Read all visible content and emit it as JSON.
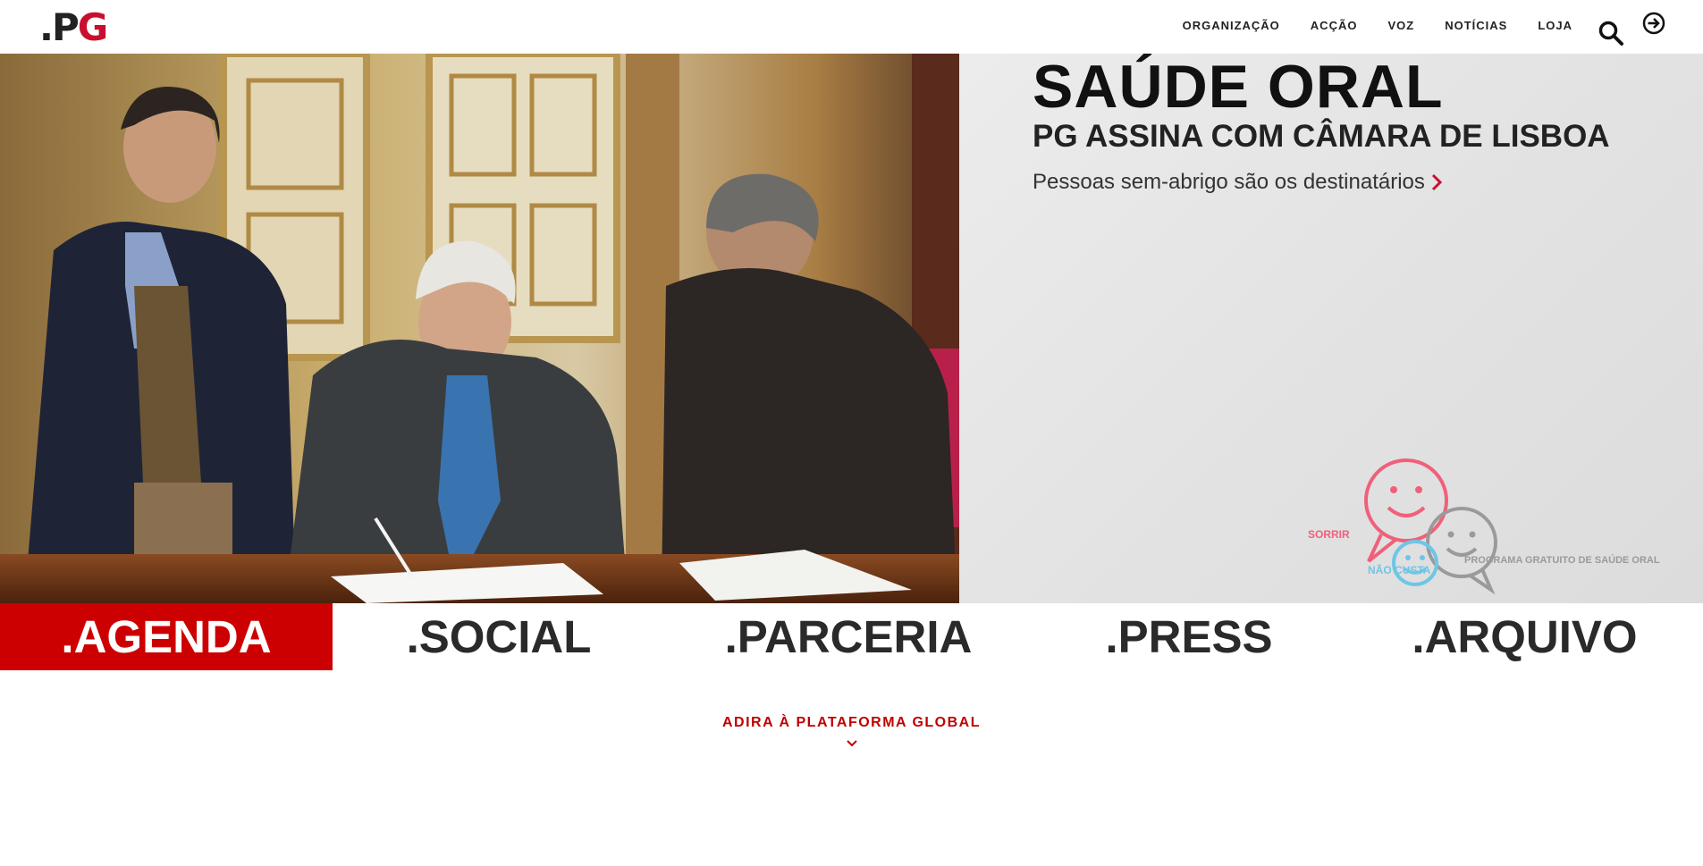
{
  "brand": {
    "logo_prefix": ".P",
    "logo_accent": "G",
    "accent_color": "#c8102e"
  },
  "nav": {
    "items": [
      {
        "label": "ORGANIZAÇÃO"
      },
      {
        "label": "ACÇÃO"
      },
      {
        "label": "VOZ"
      },
      {
        "label": "NOTÍCIAS"
      },
      {
        "label": "LOJA"
      }
    ],
    "search_icon": "search-icon",
    "login_icon": "login-arrow-icon"
  },
  "hero": {
    "title": "SAÚDE ORAL",
    "subtitle": "PG ASSINA COM CÂMARA DE LISBOA",
    "link_text": "Pessoas sem-abrigo são os destinatários",
    "promo": {
      "sorrir": "SORRIR",
      "nao_custa": "NÃO CUSTA",
      "programa": "PROGRAMA GRATUITO DE SAÚDE ORAL",
      "colors": {
        "pink": "#f0607a",
        "blue": "#6ec6e6",
        "grey": "#9a9a9a"
      }
    }
  },
  "categories": [
    {
      "label": ".AGENDA",
      "active": true
    },
    {
      "label": ".SOCIAL",
      "active": false
    },
    {
      "label": ".PARCERIA",
      "active": false
    },
    {
      "label": ".PRESS",
      "active": false
    },
    {
      "label": ".ARQUIVO",
      "active": false
    }
  ],
  "join": {
    "label": "ADIRA À PLATAFORMA GLOBAL",
    "color": "#c00000"
  }
}
